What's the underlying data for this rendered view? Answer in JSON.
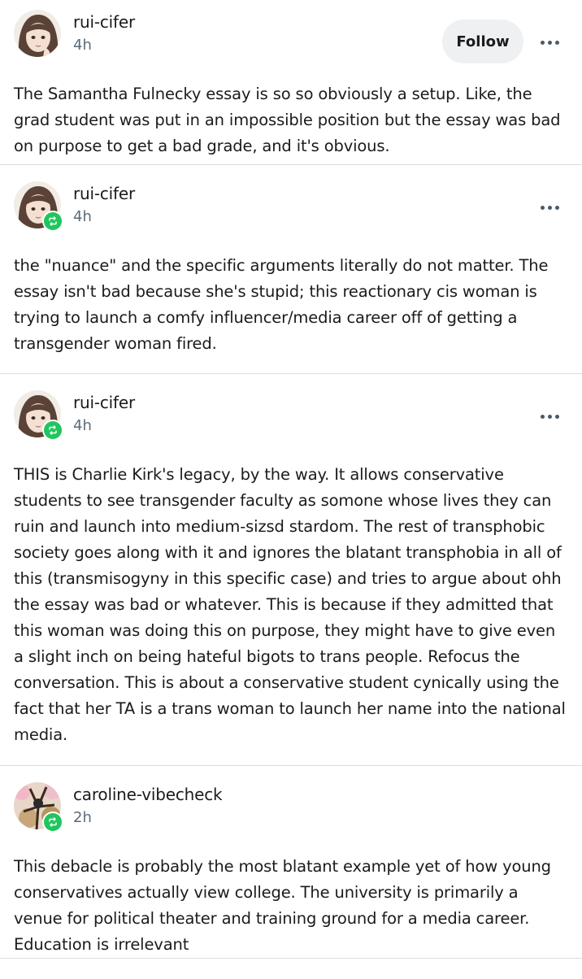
{
  "posts": [
    {
      "username": "rui-cifer",
      "time": "4h",
      "follow_label": "Follow",
      "avatar_icon": "anime-avatar-icon",
      "reblog": false,
      "text": "The Samantha Fulnecky essay is so so obviously a setup. Like, the grad student was put in an impossible position but the essay was bad on purpose to get a bad grade, and it's obvious."
    },
    {
      "username": "rui-cifer",
      "time": "4h",
      "avatar_icon": "anime-avatar-icon",
      "reblog": true,
      "text": "the \"nuance\" and the specific arguments literally do not matter. The essay isn't bad because she's stupid; this reactionary cis woman is trying to launch a comfy influencer/media career off of getting a transgender woman fired."
    },
    {
      "username": "rui-cifer",
      "time": "4h",
      "avatar_icon": "anime-avatar-icon",
      "reblog": true,
      "text": "THIS is Charlie Kirk's legacy, by the way. It allows conservative students to see transgender faculty as somone whose lives they can ruin and launch into medium-sizsd stardom. The rest of transphobic society goes along with it and ignores the blatant transphobia in all of this (transmisogyny in this specific case) and tries to argue about ohh the essay was bad or whatever. This is because if they admitted that this woman was doing this on purpose, they might have to give even a slight inch on being hateful bigots to trans people. Refocus the conversation. This is about a conservative student cynically using the fact that her TA is a trans woman to launch her name into the national media."
    },
    {
      "username": "caroline-vibecheck",
      "time": "2h",
      "avatar_icon": "blossom-avatar-icon",
      "reblog": true,
      "text": "This debacle is probably the most blatant example yet of how young conservatives actually view college. The university is primarily a venue for political theater and training ground for a media career. Education is irrelevant"
    }
  ],
  "colors": {
    "reblog_green": "#20c55d",
    "timestamp": "#5c6b7a",
    "divider": "#dddddd",
    "follow_bg": "#eff0f2"
  }
}
